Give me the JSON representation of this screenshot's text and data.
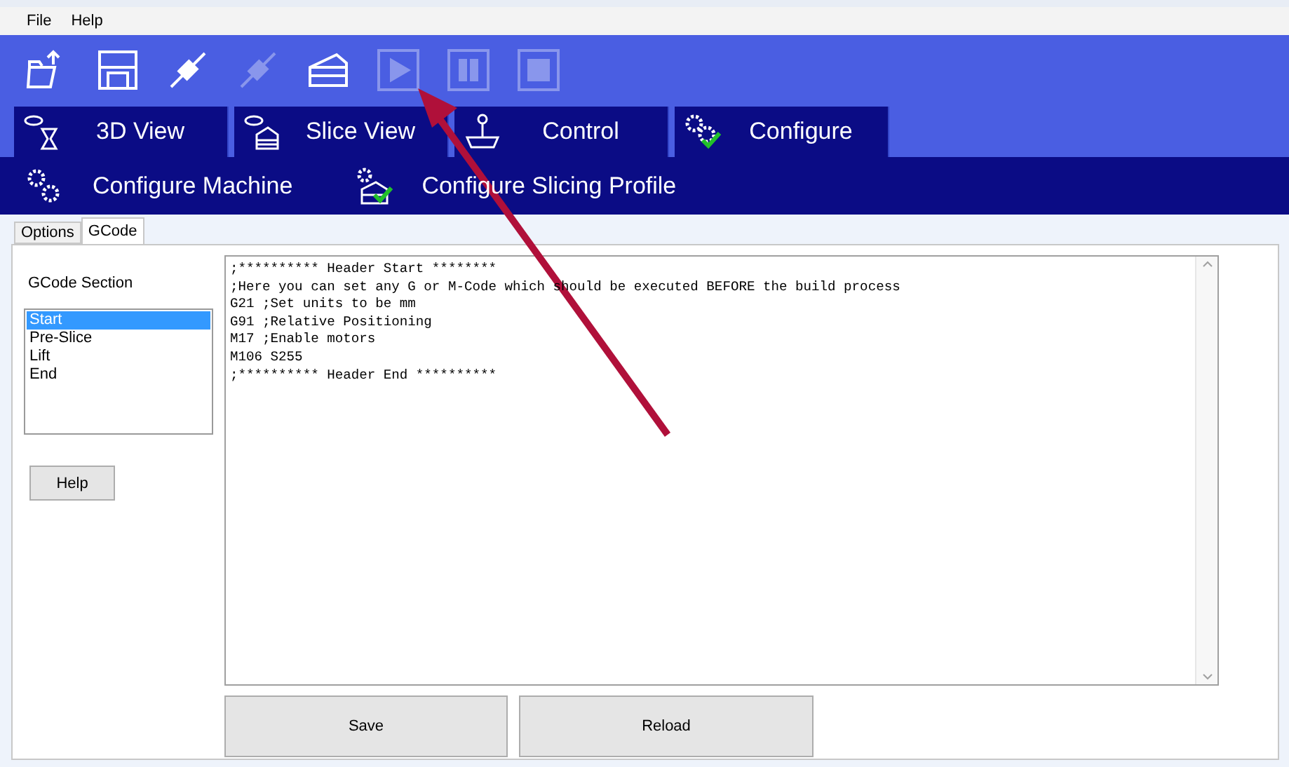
{
  "menu": [
    "File",
    "Help"
  ],
  "toolbar": [
    {
      "kind": "open",
      "disabled": false
    },
    {
      "kind": "save",
      "disabled": false
    },
    {
      "kind": "connect",
      "disabled": false
    },
    {
      "kind": "disconnect",
      "disabled": true
    },
    {
      "kind": "slice",
      "disabled": false
    },
    {
      "kind": "play",
      "disabled": true
    },
    {
      "kind": "pause",
      "disabled": true
    },
    {
      "kind": "stop",
      "disabled": true
    }
  ],
  "main_tabs": [
    {
      "label": "3D View",
      "kind": "view3d"
    },
    {
      "label": "Slice View",
      "kind": "sliceview"
    },
    {
      "label": "Control",
      "kind": "joystick"
    },
    {
      "label": "Configure",
      "kind": "gearscheck"
    }
  ],
  "sub_tabs": [
    {
      "label": "Configure Machine",
      "kind": "gears"
    },
    {
      "label": "Configure Slicing Profile",
      "kind": "slicecheck"
    }
  ],
  "page_tabs": [
    {
      "label": "Options",
      "selected": false
    },
    {
      "label": "GCode",
      "selected": true
    }
  ],
  "section_label": "GCode Section",
  "sections": [
    {
      "label": "Start",
      "selected": true
    },
    {
      "label": "Pre-Slice",
      "selected": false
    },
    {
      "label": "Lift",
      "selected": false
    },
    {
      "label": "End",
      "selected": false
    }
  ],
  "help_button": "Help",
  "gcode_lines": [
    ";********** Header Start ********",
    ";Here you can set any G or M-Code which should be executed BEFORE the build process",
    "G21 ;Set units to be mm",
    "G91 ;Relative Positioning",
    "M17 ;Enable motors",
    "M106 S255",
    ";********** Header End **********"
  ],
  "buttons": [
    "Save",
    "Reload"
  ]
}
